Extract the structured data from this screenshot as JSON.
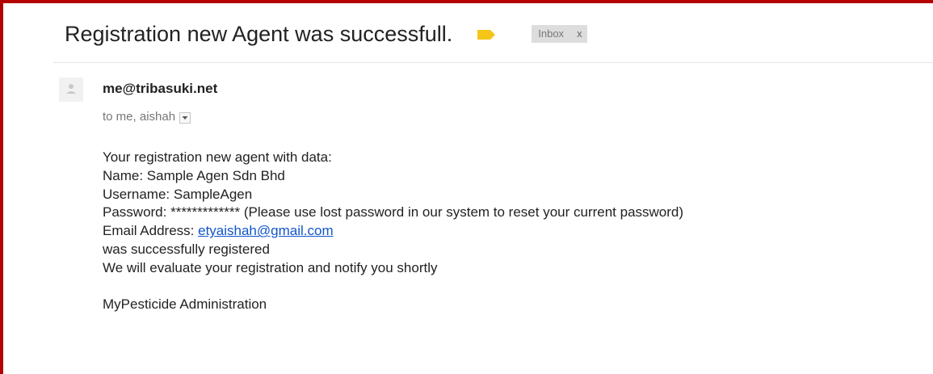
{
  "email": {
    "subject": "Registration new Agent was successfull.",
    "label_chip": {
      "text": "Inbox",
      "remove": "x"
    },
    "sender": "me@tribasuki.net",
    "recipients": "to me, aishah",
    "body": {
      "line1": "Your registration new agent with data:",
      "name_line": "Name: Sample Agen Sdn Bhd",
      "username_line": "Username: SampleAgen",
      "password_line": "Password: ************* (Please use lost password in our system to reset your current password)",
      "email_label": "Email Address: ",
      "email_link": "etyaishah@gmail.com",
      "registered_line": "was successfully registered",
      "evaluate_line": "We will evaluate your registration and notify you shortly",
      "signature": "MyPesticide Administration"
    }
  },
  "colors": {
    "frame_border": "#b30000",
    "importance_marker": "#f5c518",
    "link": "#1155cc",
    "chip_background": "#dddddd"
  },
  "icons": {
    "importance": "importance-marker-icon",
    "avatar": "person-icon",
    "details": "chevron-down-icon"
  }
}
